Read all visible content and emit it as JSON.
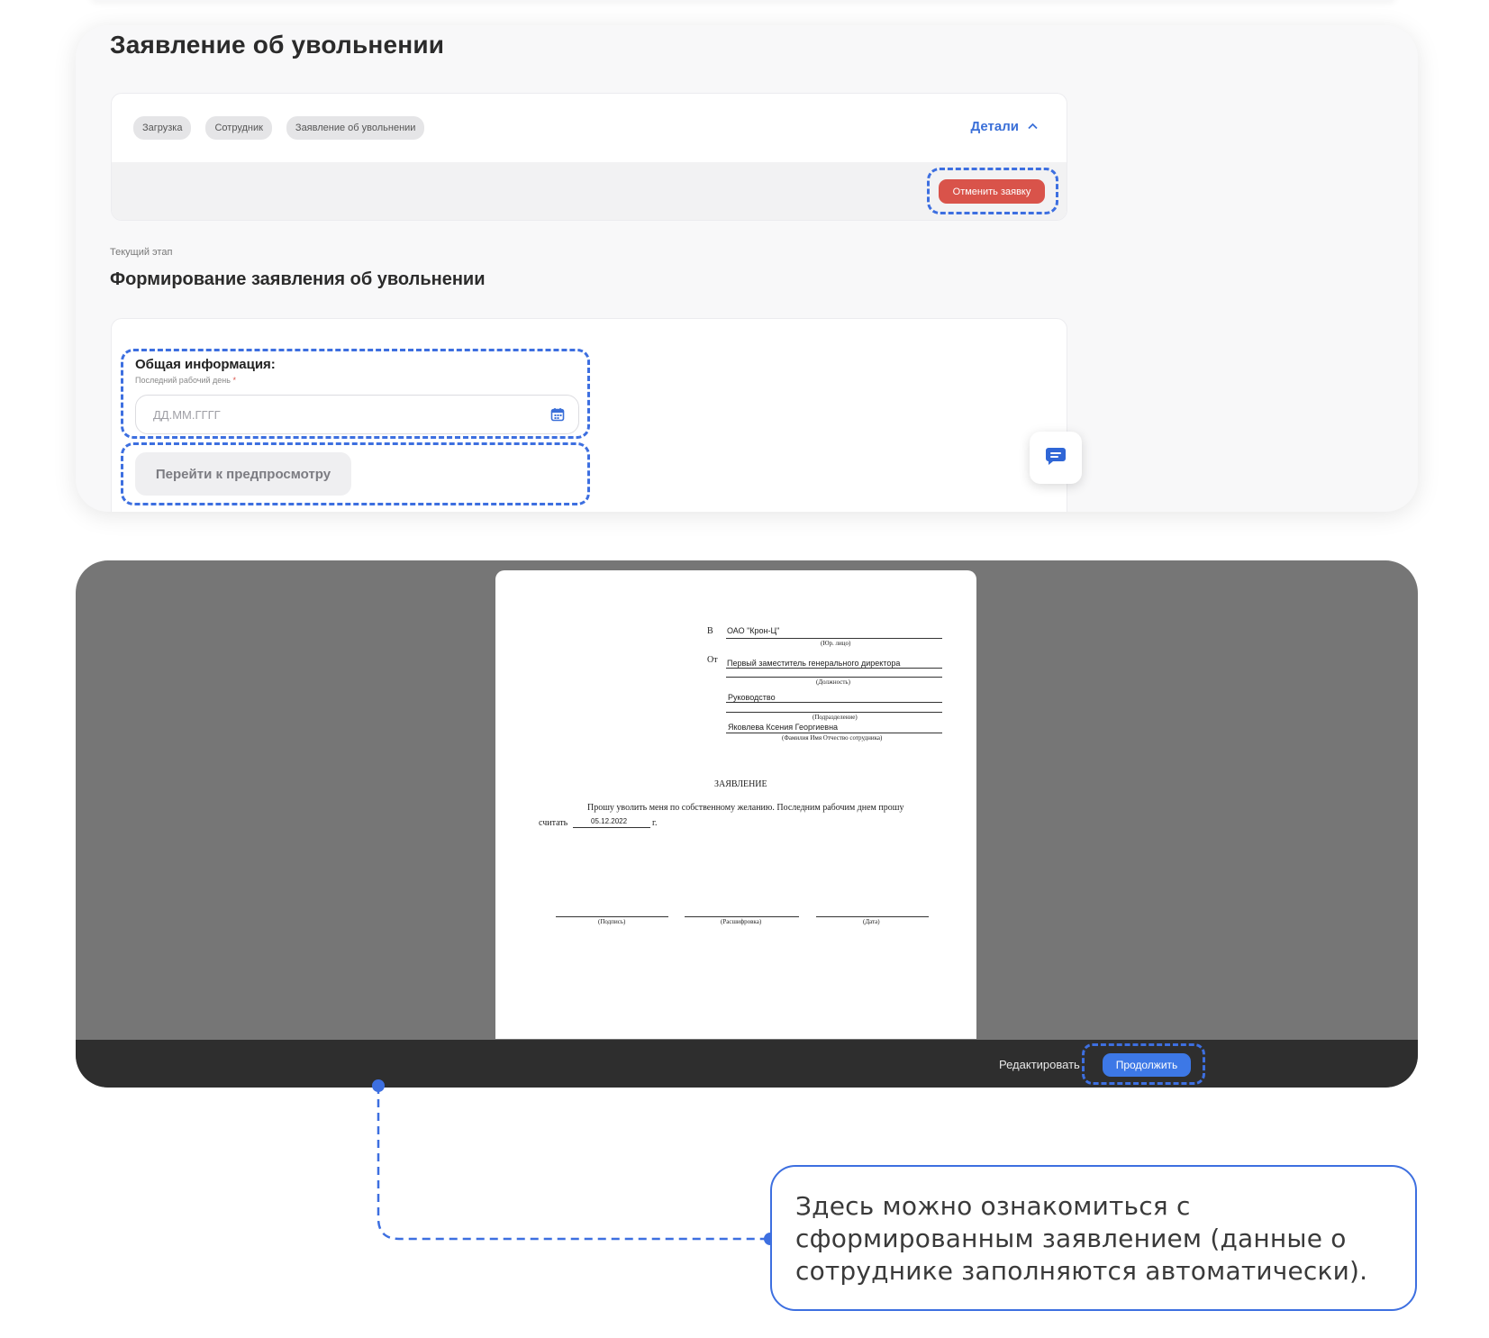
{
  "page": {
    "title": "Заявление об увольнении"
  },
  "stepper": {
    "chips": [
      "Загрузка",
      "Сотрудник",
      "Заявление об увольнении"
    ],
    "details_label": "Детали",
    "cancel_label": "Отменить заявку"
  },
  "stage": {
    "label": "Текущий этап",
    "title": "Формирование заявления об увольнении"
  },
  "form": {
    "section_title": "Общая информация:",
    "last_day_label": "Последний рабочий день",
    "required_mark": "*",
    "last_day_placeholder": "ДД.ММ.ГГГГ",
    "preview_button": "Перейти к предпросмотру"
  },
  "document": {
    "to_prefix": "В",
    "organization": "ОАО \"Крон-Ц\"",
    "org_caption": "(Юр. лицо)",
    "from_prefix": "От",
    "position": "Первый заместитель генерального директора",
    "position_caption": "(Должность)",
    "department": "Руководство",
    "department_caption": "(Подразделение)",
    "employee": "Яковлева Ксения Георгиевна",
    "employee_caption": "(Фамилия Имя Отчество сотрудника)",
    "heading": "ЗАЯВЛЕНИЕ",
    "body_line1": "Прошу уволить меня по собственному желанию. Последним рабочим днем прошу",
    "body_line2_prefix": "считать",
    "last_day_value": "05.12.2022",
    "body_line2_suffix": "г.",
    "sign_caption": "(Подпись)",
    "decode_caption": "(Расшифровка)",
    "date_caption": "(Дата)"
  },
  "preview_bar": {
    "edit_label": "Редактировать",
    "continue_label": "Продолжить"
  },
  "callout": {
    "text": "Здесь можно ознакомиться с сформированным заявлением (данные о сотруднике заполняются автоматически)."
  },
  "colors": {
    "accent": "#3d6fe0",
    "danger": "#d9534a",
    "primary_button": "#3d78e6",
    "preview_backdrop": "#767676",
    "preview_toolbar": "#2e2e2e"
  },
  "icons": {
    "details_toggle": "chevron-up-icon",
    "date_input": "calendar-icon",
    "chat": "chat-icon"
  }
}
